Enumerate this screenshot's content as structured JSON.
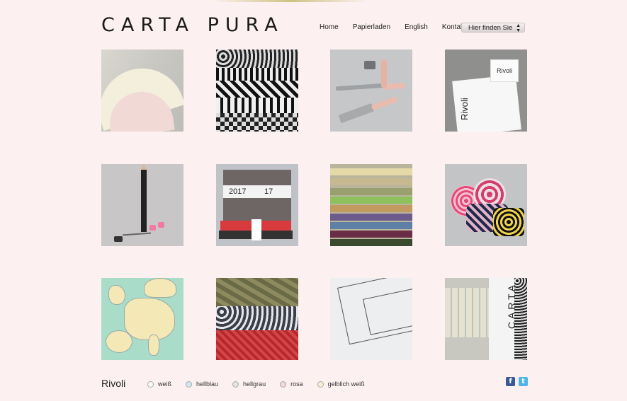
{
  "brand": {
    "logo_text": "CARTA PURA"
  },
  "nav": {
    "items": [
      "Home",
      "Papierladen",
      "English",
      "Kontakt"
    ],
    "location_select": "Hier finden Sie"
  },
  "tiles": {
    "t4": {
      "tent_text": "Rivoli",
      "card_text": "Rivoli"
    },
    "t6": {
      "year_left": "2017",
      "year_right": "17"
    },
    "t12": {
      "banner_text": "CARTA"
    }
  },
  "product": {
    "name": "Rivoli",
    "colors": [
      "weiß",
      "hellblau",
      "hellgrau",
      "rosa",
      "gelblich weiß"
    ],
    "radio_colors": [
      "#ffffff",
      "#cfe8f2",
      "#e3e3e3",
      "#f4d6dc",
      "#f6efd6"
    ]
  },
  "icons": {
    "facebook": "facebook-icon",
    "twitter": "twitter-icon"
  }
}
